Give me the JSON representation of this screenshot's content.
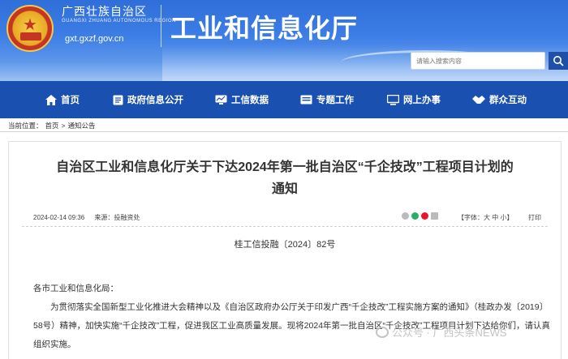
{
  "header": {
    "region": "广西壮族自治区",
    "region_en": "GUANGXI ZHUANG AUTONOMOUS REGION",
    "url": "gxt.gxzf.gov.cn",
    "dept": "工业和信息化厅",
    "search_placeholder": "请输入搜索内容"
  },
  "nav": {
    "items": [
      {
        "label": "首页",
        "icon": "home-icon"
      },
      {
        "label": "政府信息公开",
        "icon": "document-icon"
      },
      {
        "label": "工信数据",
        "icon": "data-icon"
      },
      {
        "label": "专题工作",
        "icon": "folder-icon"
      },
      {
        "label": "网上办事",
        "icon": "monitor-icon"
      },
      {
        "label": "群众互动",
        "icon": "handshake-icon"
      }
    ]
  },
  "breadcrumb": {
    "prefix": "当前位置：",
    "home": "首页",
    "sep": ">",
    "current": "通知公告"
  },
  "article": {
    "title_line1": "自治区工业和信息化厅关于下达2024年第一批自治区“千企技改”工程项目计划的",
    "title_line2": "通知",
    "date": "2024-02-14 09:36",
    "source": "来源：投融资处",
    "font_label": "【字体：",
    "font_large": "大",
    "font_medium": "中",
    "font_small": "小",
    "font_end": "】",
    "print": "打印",
    "doc_number": "桂工信投融〔2024〕82号",
    "salutation": "各市工业和信息化局：",
    "paragraph": "为贯彻落实全国新型工业化推进大会精神以及《自治区政府办公厅关于印发广西“千企技改”工程实施方案的通知》（桂政办发〔2019〕58号）精神，加快实施“千企技改”工程，促进我区工业高质量发展。现将2024年第一批自治区“千企技改”工程项目计划下达给你们，请认真组织实施。"
  },
  "watermark": "公众号 · 广西头条NEWS",
  "colors": {
    "nav_bg": "#1a50b0",
    "header_top": "#2f6ed8"
  }
}
